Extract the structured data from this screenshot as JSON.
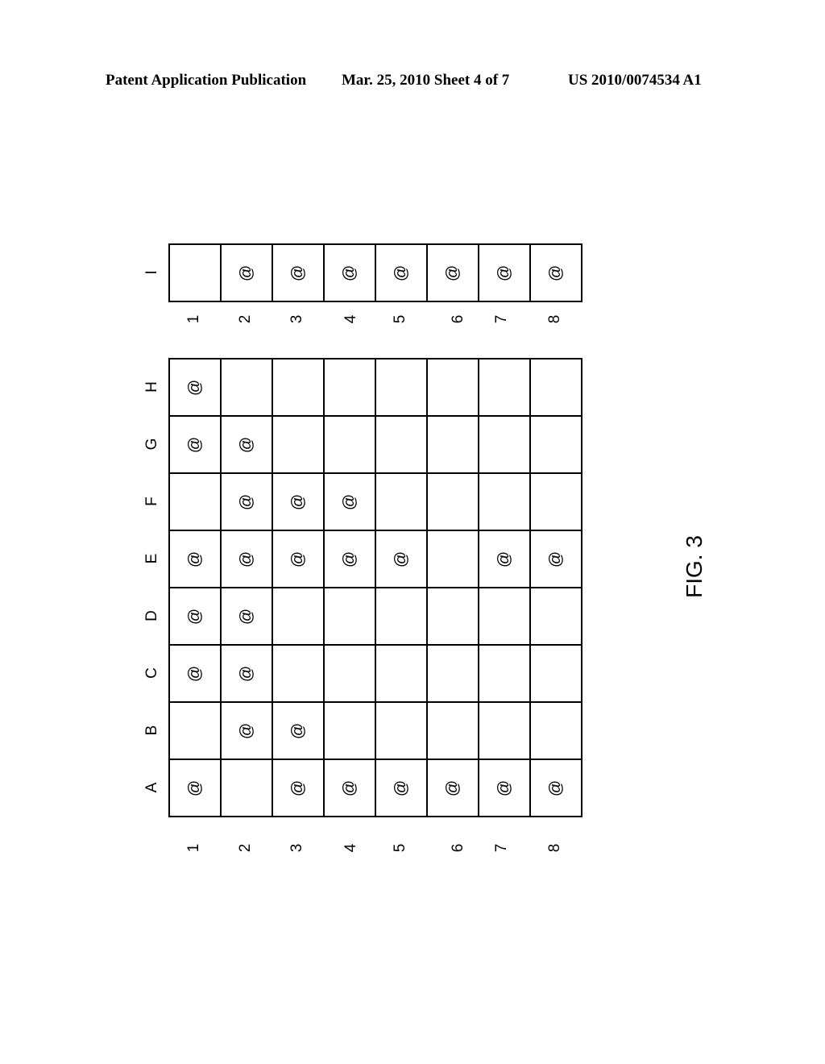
{
  "header": {
    "left": "Patent Application Publication",
    "middle": "Mar. 25, 2010  Sheet 4 of 7",
    "right": "US 2010/0074534 A1"
  },
  "figure_label": "FIG. 3",
  "cell_marker": "@",
  "column_numbers": [
    "1",
    "2",
    "3",
    "4",
    "5",
    "6",
    "7",
    "8"
  ],
  "top_table": {
    "rows": [
      {
        "label": "I",
        "cells": [
          false,
          true,
          true,
          true,
          true,
          true,
          true,
          true
        ]
      }
    ]
  },
  "main_table": {
    "rows": [
      {
        "label": "H",
        "cells": [
          true,
          false,
          false,
          false,
          false,
          false,
          false,
          false
        ]
      },
      {
        "label": "G",
        "cells": [
          true,
          true,
          false,
          false,
          false,
          false,
          false,
          false
        ]
      },
      {
        "label": "F",
        "cells": [
          false,
          true,
          true,
          true,
          false,
          false,
          false,
          false
        ]
      },
      {
        "label": "E",
        "cells": [
          true,
          true,
          true,
          true,
          true,
          false,
          true,
          true
        ]
      },
      {
        "label": "D",
        "cells": [
          true,
          true,
          false,
          false,
          false,
          false,
          false,
          false
        ]
      },
      {
        "label": "C",
        "cells": [
          true,
          true,
          false,
          false,
          false,
          false,
          false,
          false
        ]
      },
      {
        "label": "B",
        "cells": [
          false,
          true,
          true,
          false,
          false,
          false,
          false,
          false
        ]
      },
      {
        "label": "A",
        "cells": [
          true,
          false,
          true,
          true,
          true,
          true,
          true,
          true
        ]
      }
    ]
  }
}
